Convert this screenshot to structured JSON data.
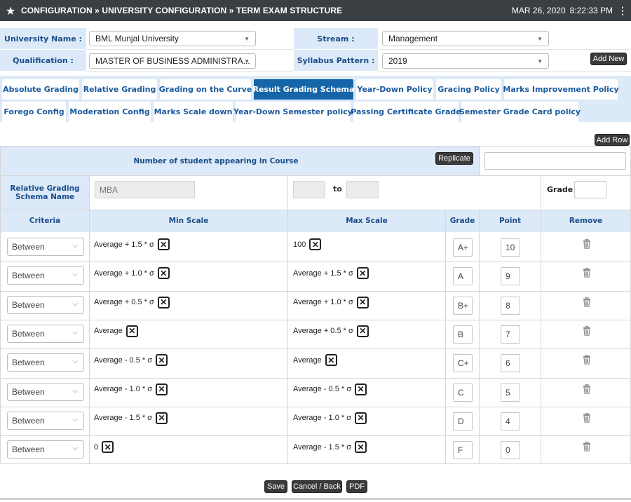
{
  "topbar": {
    "breadcrumb": "CONFIGURATION » UNIVERSITY CONFIGURATION » TERM EXAM STRUCTURE",
    "date": "MAR 26, 2020",
    "time": "8:22:33 PM"
  },
  "filters": {
    "university_label": "University Name :",
    "university_value": "BML Munjal University",
    "stream_label": "Stream :",
    "stream_value": "Management",
    "qualification_label": "Qualification :",
    "qualification_value": "MASTER OF BUSINESS ADMINISTRA...",
    "syllabus_label": "Syllabus Pattern :",
    "syllabus_value": "2019",
    "add_new": "Add New"
  },
  "tabs": {
    "row1": [
      "Absolute Grading",
      "Relative Grading",
      "Grading on the Curve",
      "Result Grading Schema",
      "Year-Down Policy",
      "Gracing Policy",
      "Marks Improvement Policy"
    ],
    "row2": [
      "Forego Config",
      "Moderation Config",
      "Marks Scale down",
      "Year-Down Semester policy",
      "Passing Certificate Grade",
      "Semester Grade Card policy"
    ],
    "active": "Result Grading Schema"
  },
  "grid": {
    "add_row": "Add Row",
    "students_label": "Number of student appearing in Course",
    "replicate": "Replicate",
    "students_value": "",
    "schema_name_label": "Relative Grading Schema Name",
    "schema_name_value": "MBA",
    "range_from": "",
    "range_to_label": "to",
    "range_to": "",
    "grade_label": "Grade",
    "grade_value": "",
    "headers": {
      "criteria": "Criteria",
      "min_scale": "Min Scale",
      "max_scale": "Max Scale",
      "grade": "Grade",
      "point": "Point",
      "remove": "Remove"
    },
    "rows": [
      {
        "criteria": "Between",
        "min": "Average + 1.5 * σ",
        "max": "100",
        "grade": "A+",
        "point": "10"
      },
      {
        "criteria": "Between",
        "min": "Average + 1.0 * σ",
        "max": "Average + 1.5 * σ",
        "grade": "A",
        "point": "9"
      },
      {
        "criteria": "Between",
        "min": "Average + 0.5 * σ",
        "max": "Average + 1.0 * σ",
        "grade": "B+",
        "point": "8"
      },
      {
        "criteria": "Between",
        "min": "Average",
        "max": "Average + 0.5 * σ",
        "grade": "B",
        "point": "7"
      },
      {
        "criteria": "Between",
        "min": "Average - 0.5 * σ",
        "max": "Average",
        "grade": "C+",
        "point": "6"
      },
      {
        "criteria": "Between",
        "min": "Average - 1.0 * σ",
        "max": "Average - 0.5 * σ",
        "grade": "C",
        "point": "5"
      },
      {
        "criteria": "Between",
        "min": "Average - 1.5 * σ",
        "max": "Average - 1.0 * σ",
        "grade": "D",
        "point": "4"
      },
      {
        "criteria": "Between",
        "min": "0",
        "max": "Average - 1.5 * σ",
        "grade": "F",
        "point": "0"
      }
    ]
  },
  "actions": {
    "save": "Save",
    "cancel": "Cancel / Back",
    "pdf": "PDF"
  },
  "icons": {
    "star": "star-icon",
    "menu": "kebab-menu-icon",
    "remove": "trash-icon",
    "clear": "close-box-icon"
  },
  "colors": {
    "topbar": "#3a3f44",
    "header_bg": "#dce9f8",
    "header_text": "#1a4e8a",
    "active_tab": "#1565a8"
  }
}
